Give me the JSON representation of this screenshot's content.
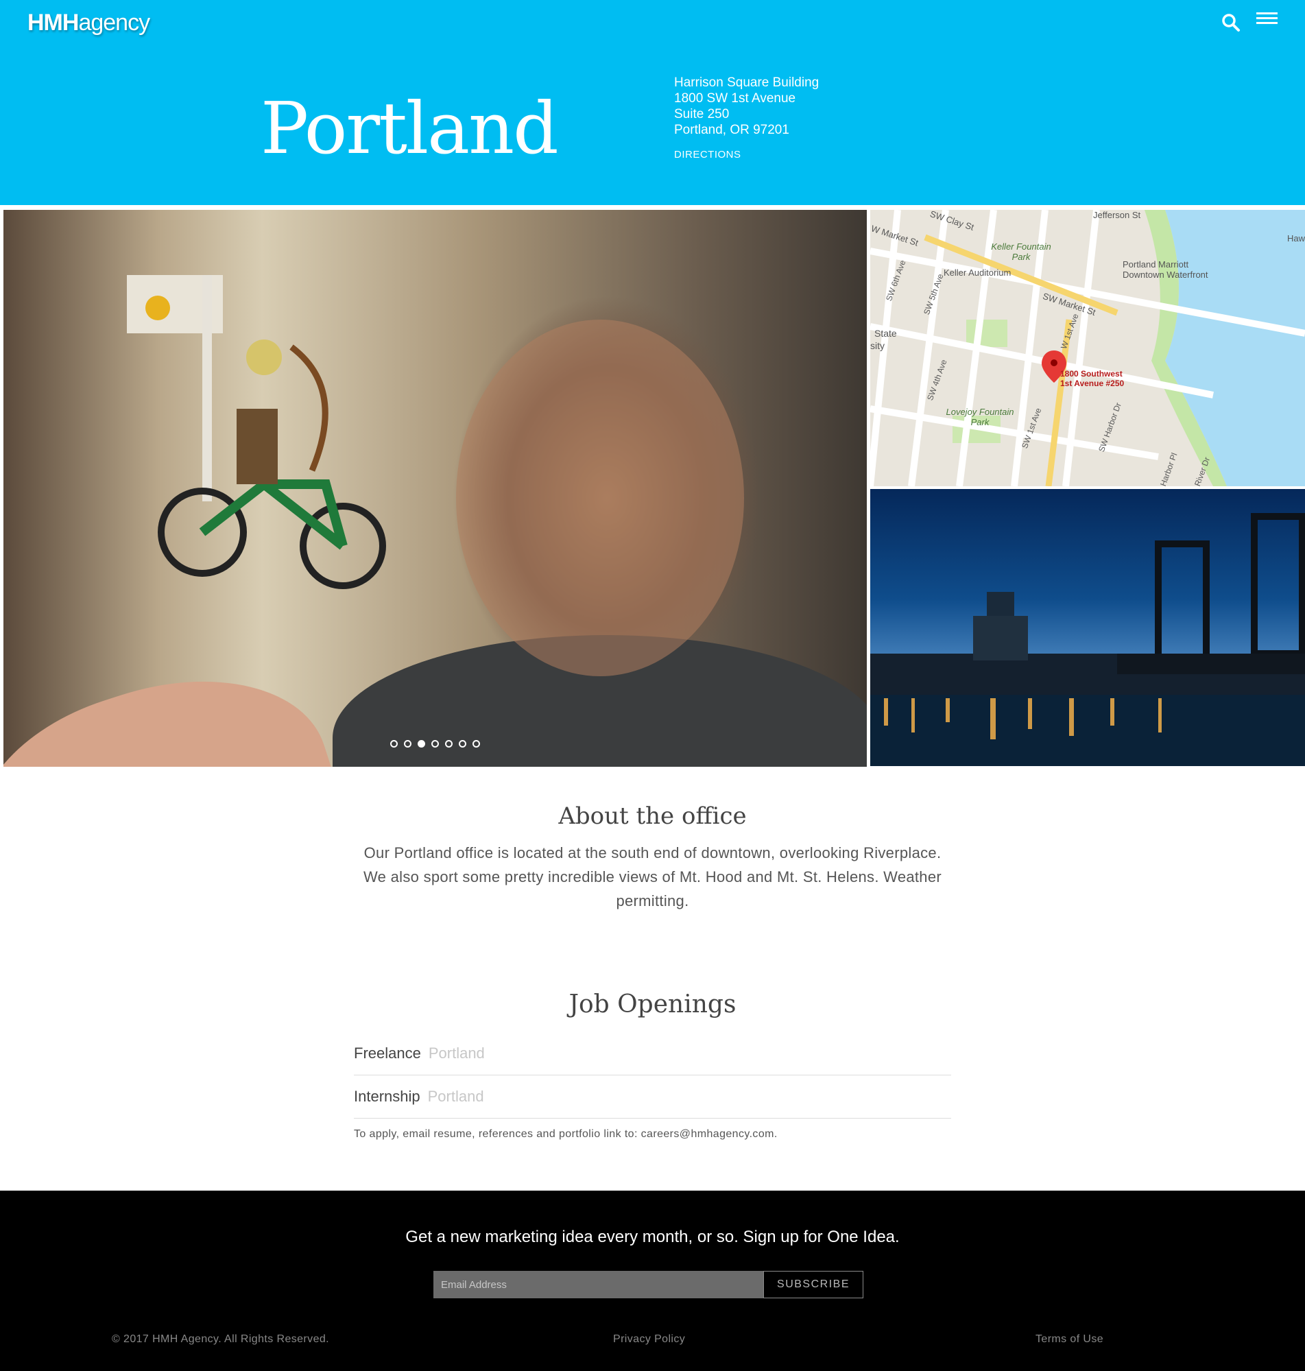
{
  "header": {
    "logo_bold": "HMH",
    "logo_regular": "agency",
    "city": "Portland",
    "address_lines": [
      "Harrison Square Building",
      "1800 SW 1st Avenue",
      "Suite 250",
      "Portland, OR 97201"
    ],
    "directions_label": "DIRECTIONS",
    "icons": [
      "search-icon",
      "hamburger-menu-icon"
    ],
    "accent_color": "#00bdf2"
  },
  "gallery": {
    "slide_count": 7,
    "active_slide": 3,
    "map": {
      "streets": [
        "SW Clay St",
        "W Market St",
        "SW Market St",
        "SW 6th Ave",
        "SW 5th Ave",
        "SW 4th Ave",
        "SW 1st Ave",
        "W 1st Ave",
        "SW Harbor Dr",
        "Harbor Pl",
        "River Dr",
        "Jefferson St"
      ],
      "places": [
        "Keller Fountain Park",
        "Keller Auditorium",
        "Portland Marriott Downtown Waterfront",
        "Lovejoy Fountain Park",
        "State",
        "sity",
        "Haw"
      ],
      "pin_label": [
        "1800 Southwest",
        "1st Avenue #250"
      ]
    }
  },
  "about": {
    "title": "About the office",
    "text": "Our Portland office is located at the south end of downtown, overlooking Riverplace. We also sport some pretty incredible views of Mt. Hood and Mt. St. Helens. Weather permitting."
  },
  "jobs": {
    "title": "Job Openings",
    "openings": [
      {
        "title": "Freelance",
        "location": "Portland"
      },
      {
        "title": "Internship",
        "location": "Portland"
      }
    ],
    "apply_text": "To apply, email resume, references and portfolio link to: careers@hmhagency.com."
  },
  "footer": {
    "promo": "Get a new marketing idea every month, or so. Sign up for One Idea.",
    "email_placeholder": "Email Address",
    "subscribe_label": "SUBSCRIBE",
    "copyright": "© 2017 HMH Agency. All Rights Reserved.",
    "privacy": "Privacy Policy",
    "terms": "Terms of Use"
  }
}
